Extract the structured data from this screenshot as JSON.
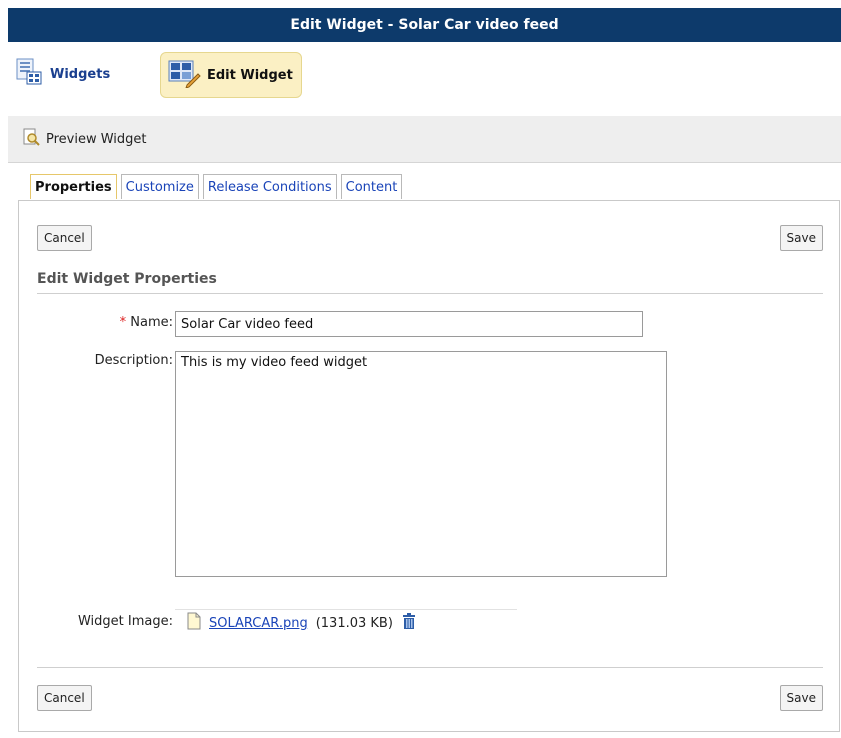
{
  "window": {
    "title": "Edit Widget - Solar Car video feed"
  },
  "nav": {
    "widgets_label": "Widgets",
    "edit_widget_label": "Edit Widget"
  },
  "toolbar": {
    "preview_label": "Preview Widget"
  },
  "tabs": [
    {
      "label": "Properties"
    },
    {
      "label": "Customize"
    },
    {
      "label": "Release Conditions"
    },
    {
      "label": "Content"
    }
  ],
  "buttons": {
    "cancel": "Cancel",
    "save": "Save"
  },
  "form": {
    "section_title": "Edit Widget Properties",
    "required_mark": "*",
    "name_label": "Name:",
    "name_value": "Solar Car video feed",
    "description_label": "Description:",
    "description_value": "This is my video feed widget",
    "image_label": "Widget Image:",
    "image_file": "SOLARCAR.png",
    "image_size": "(131.03 KB)"
  },
  "icons": {
    "widgets": "widgets-grid-icon",
    "edit": "edit-widget-icon",
    "preview": "preview-icon",
    "file": "file-icon",
    "trash": "trash-icon"
  },
  "colors": {
    "title_bar": "#0d3a6b",
    "link": "#1a44b8",
    "active_tab_border": "#e6c76a",
    "required": "#d22222"
  }
}
